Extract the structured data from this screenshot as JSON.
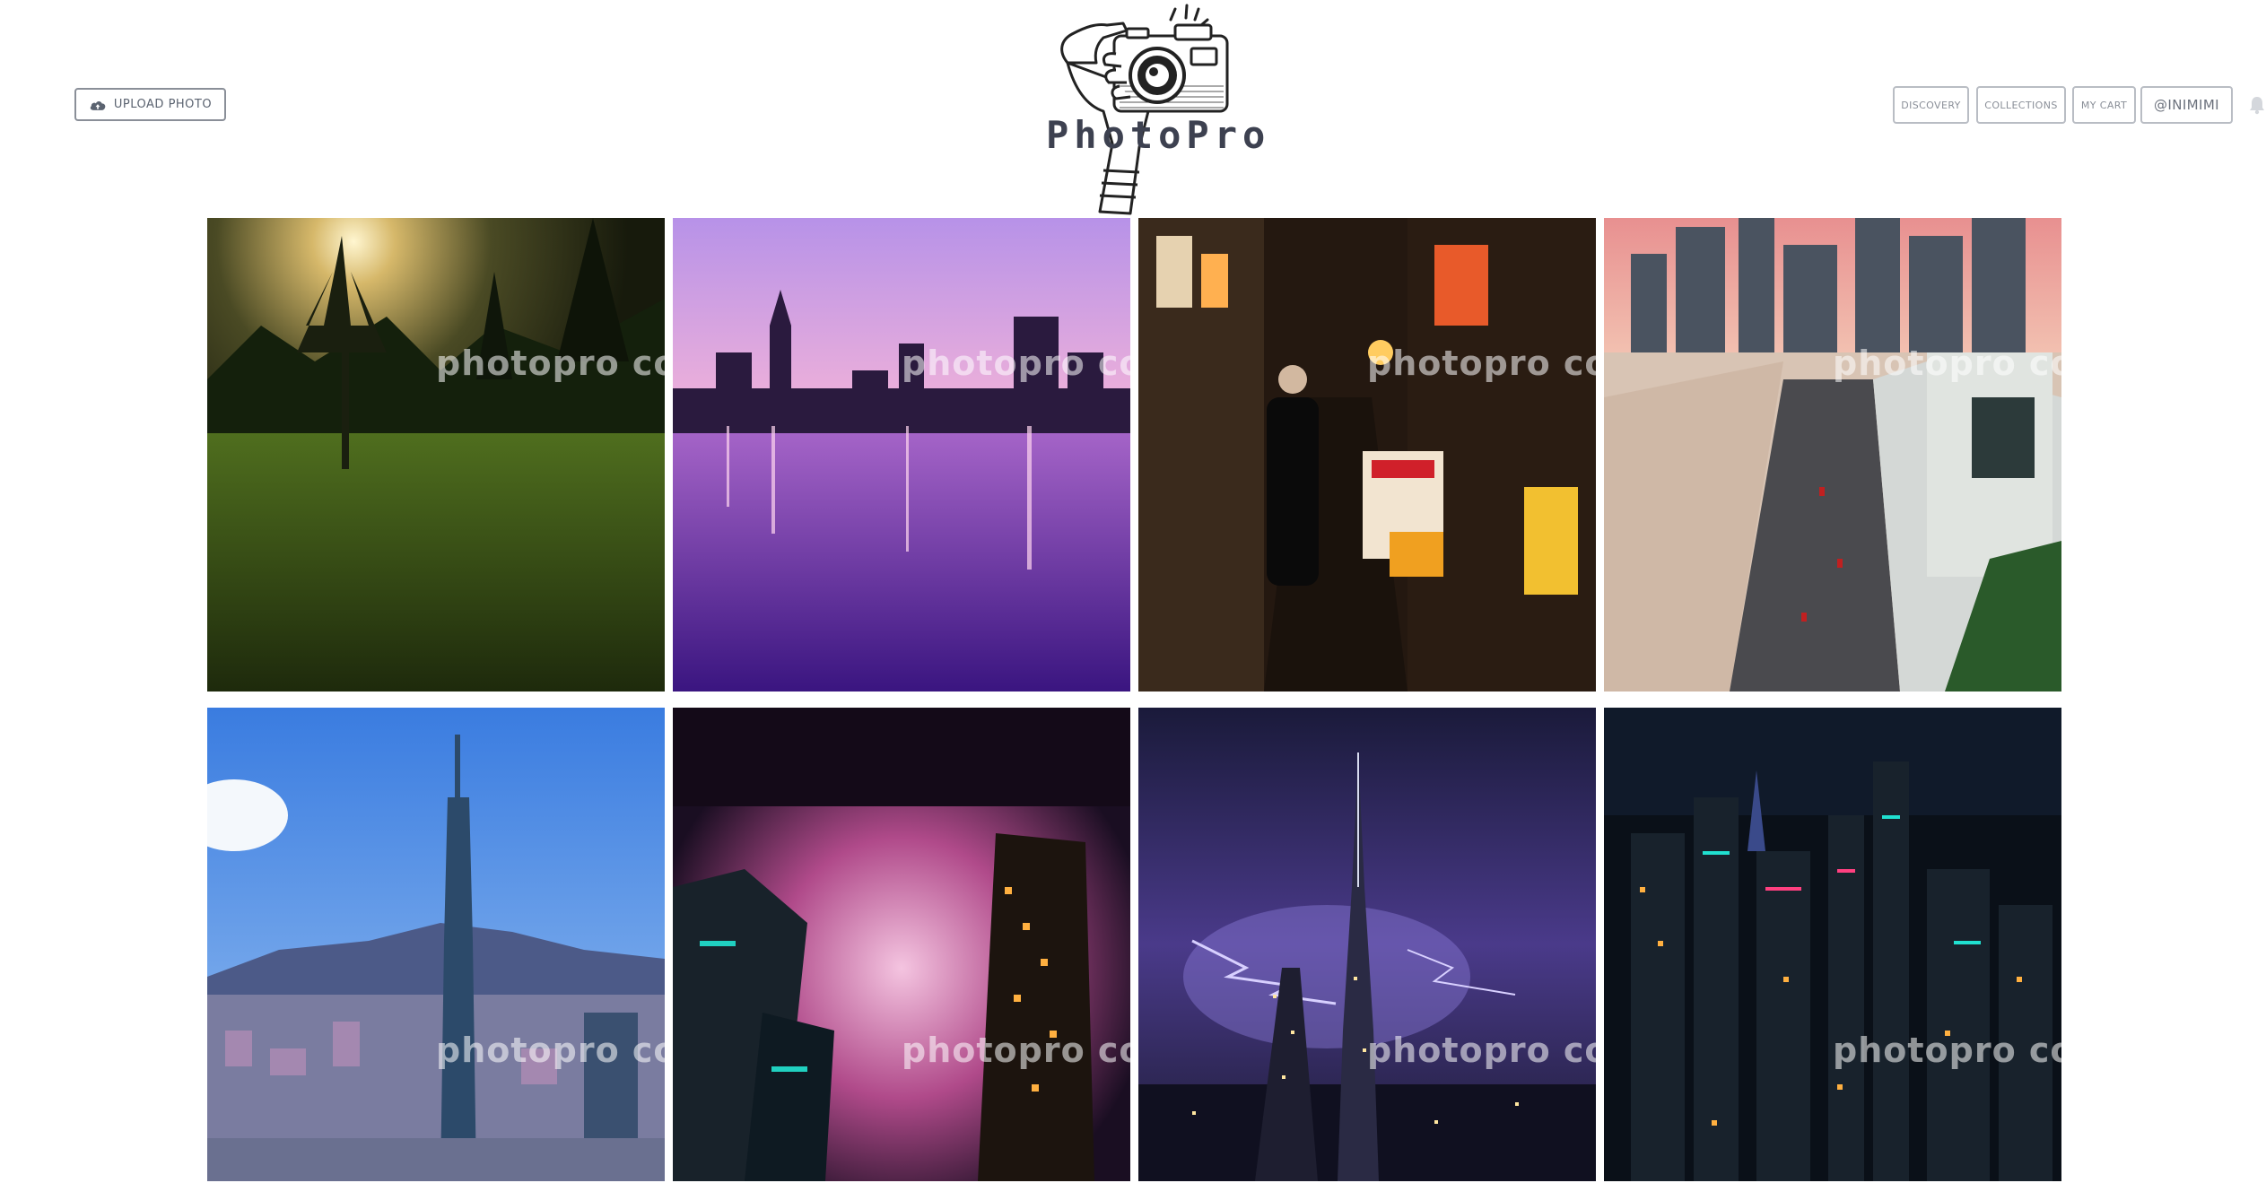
{
  "header": {
    "upload_label": "UPLOAD PHOTO",
    "upload_icon": "cloud-upload-icon",
    "logo_text": "PhotoPro",
    "nav": {
      "discovery": "DISCOVERY",
      "collections": "COLLECTIONS",
      "my_cart": "MY CART",
      "user": "@INIMIMI"
    },
    "notification_icon": "bell-icon"
  },
  "gallery": {
    "watermark": "photopro copyright",
    "photos": [
      {
        "subject": "forest-sunrise"
      },
      {
        "subject": "purple-skyline-reflection"
      },
      {
        "subject": "night-street-pedestrian"
      },
      {
        "subject": "city-highway-river"
      },
      {
        "subject": "taipei-101-tower"
      },
      {
        "subject": "foggy-skyscrapers-night"
      },
      {
        "subject": "burj-khalifa-lightning"
      },
      {
        "subject": "hong-kong-night-aerial"
      }
    ]
  },
  "colors": {
    "button_border": "#8a8f98",
    "nav_border": "#b9bdc4",
    "text_gray": "#5b6370",
    "logo_ink": "#3d4150"
  }
}
